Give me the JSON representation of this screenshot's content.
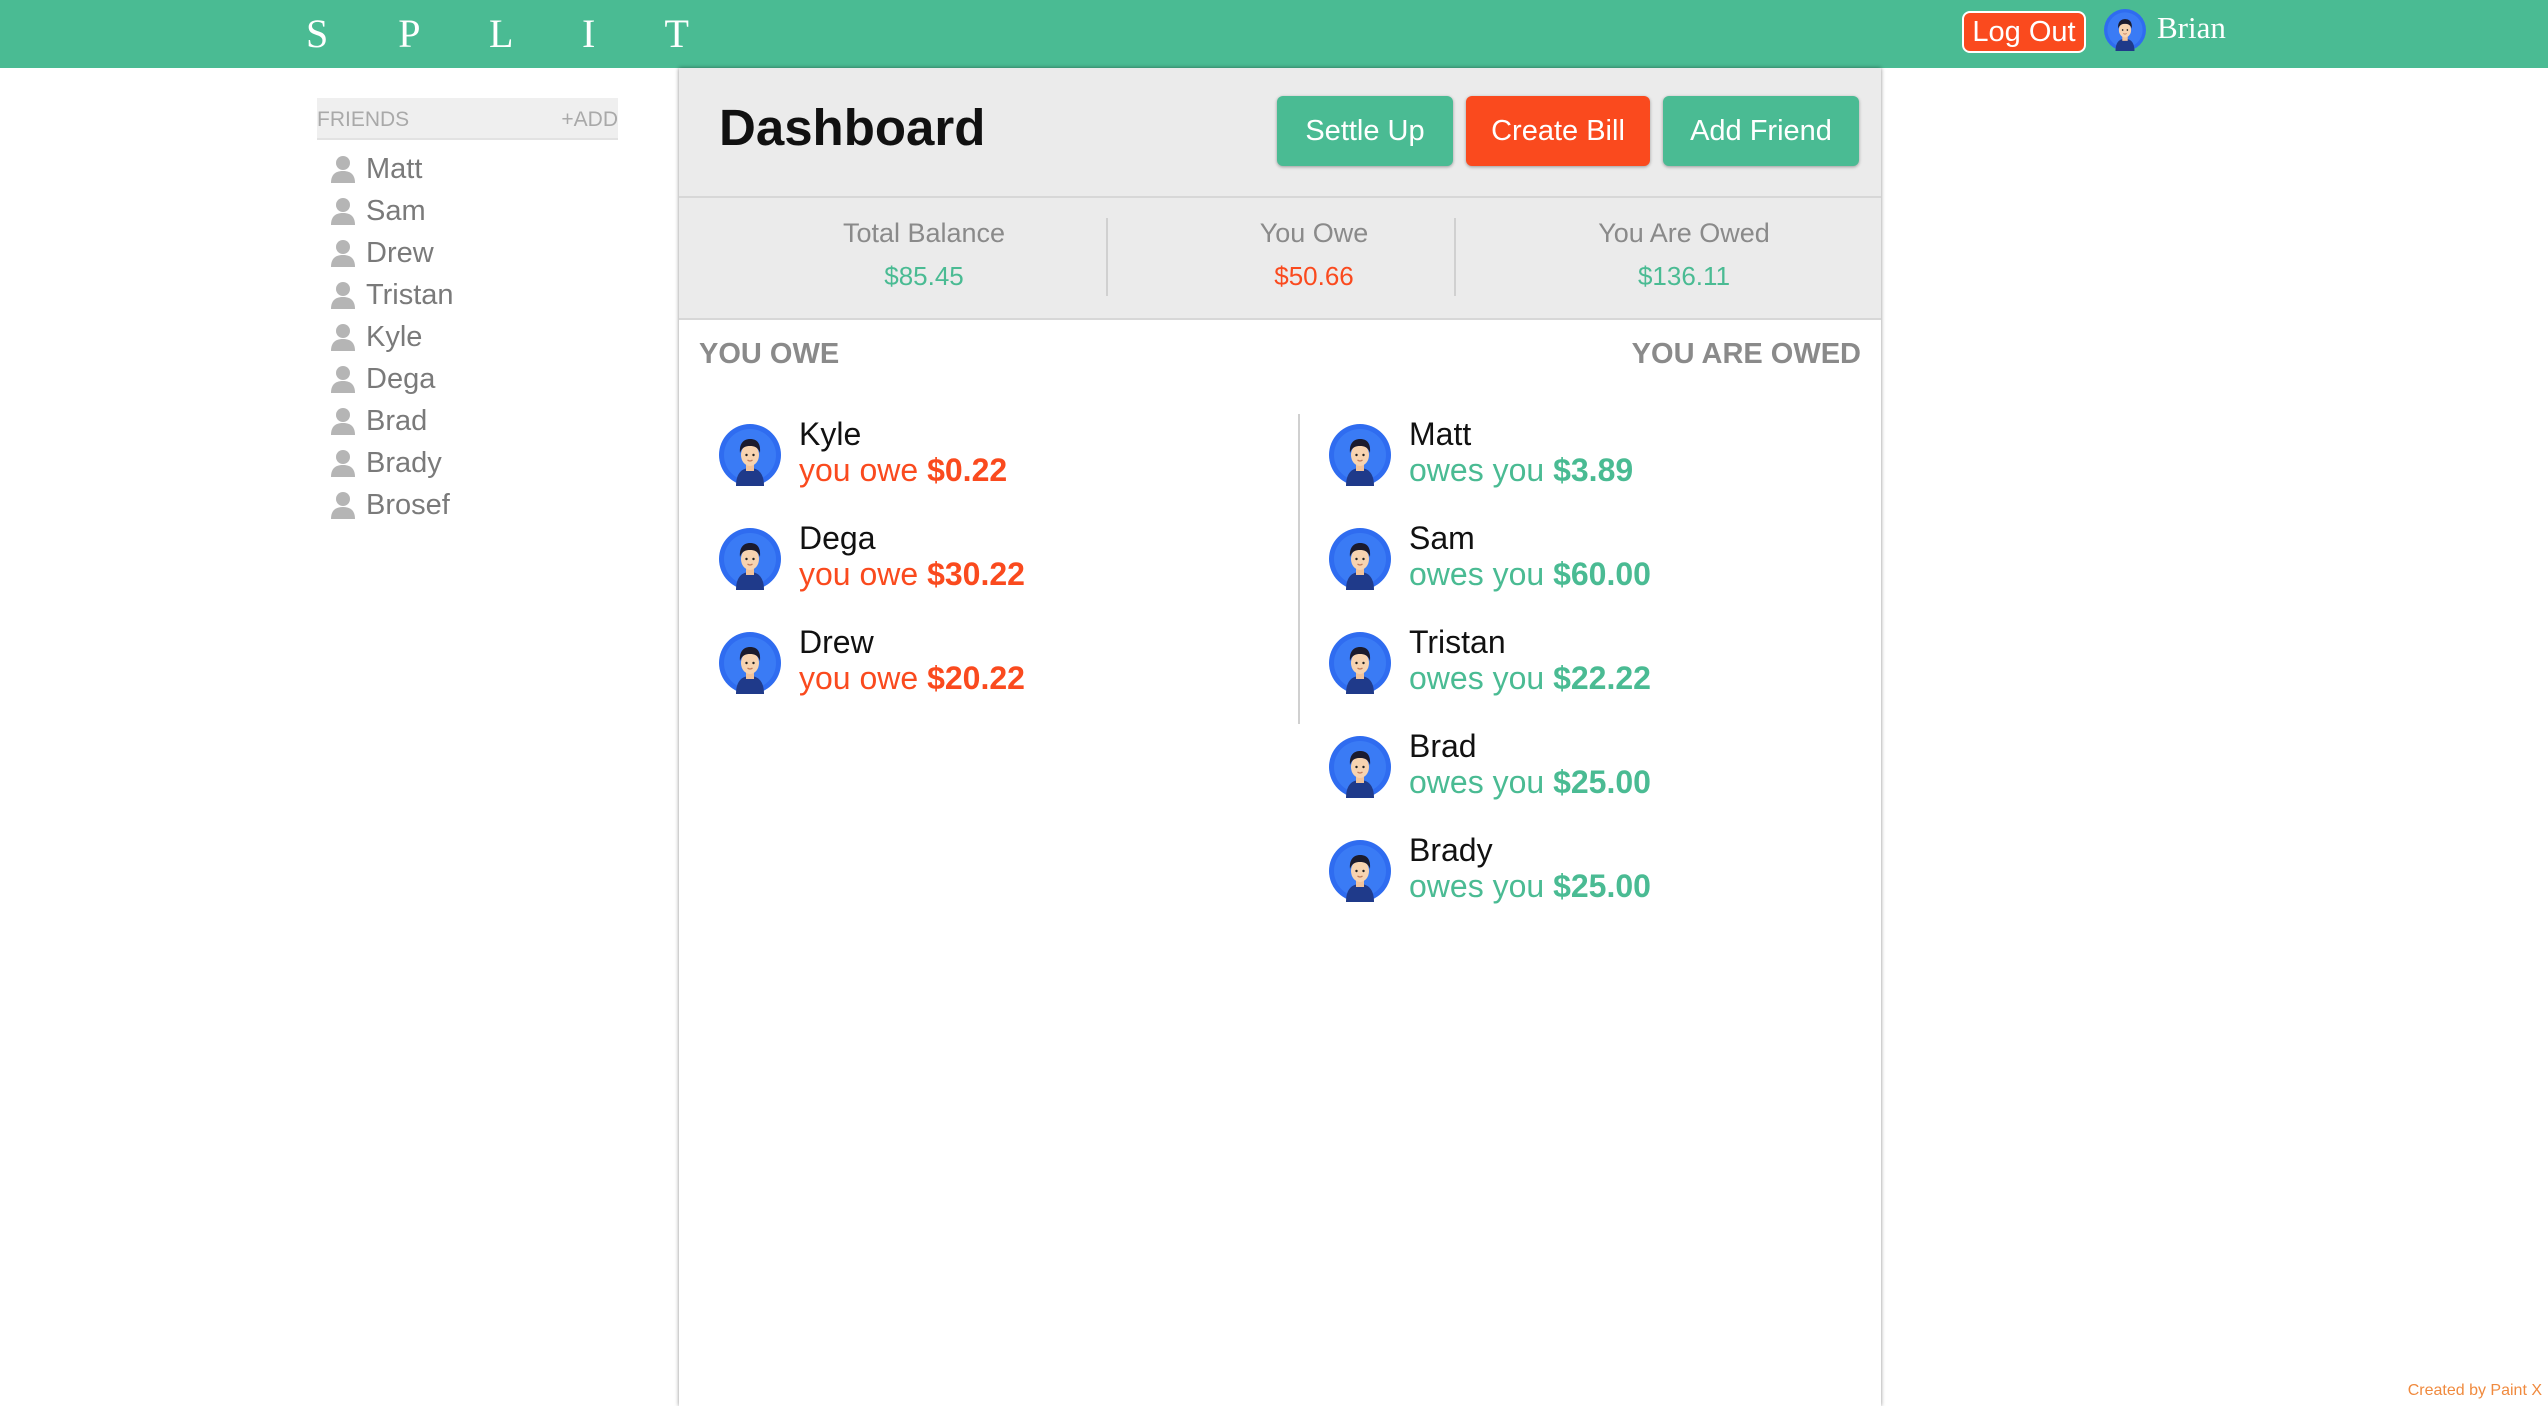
{
  "header": {
    "brand": "S P L I T",
    "logout_label": "Log Out",
    "user_name": "Brian"
  },
  "sidebar": {
    "title": "FRIENDS",
    "add_label": "+ADD",
    "friends": [
      "Matt",
      "Sam",
      "Drew",
      "Tristan",
      "Kyle",
      "Dega",
      "Brad",
      "Brady",
      "Brosef"
    ]
  },
  "dashboard": {
    "title": "Dashboard",
    "buttons": {
      "settle_up": "Settle Up",
      "create_bill": "Create Bill",
      "add_friend": "Add Friend"
    },
    "stats": {
      "total_balance_label": "Total Balance",
      "total_balance_value": "$85.45",
      "you_owe_label": "You Owe",
      "you_owe_value": "$50.66",
      "you_are_owed_label": "You Are Owed",
      "you_are_owed_value": "$136.11"
    },
    "you_owe_title": "YOU OWE",
    "you_are_owed_title": "YOU ARE OWED",
    "owe_prefix": "you owe",
    "owed_prefix": "owes you",
    "you_owe": [
      {
        "name": "Kyle",
        "amount": "$0.22"
      },
      {
        "name": "Dega",
        "amount": "$30.22"
      },
      {
        "name": "Drew",
        "amount": "$20.22"
      }
    ],
    "you_are_owed": [
      {
        "name": "Matt",
        "amount": "$3.89"
      },
      {
        "name": "Sam",
        "amount": "$60.00"
      },
      {
        "name": "Tristan",
        "amount": "$22.22"
      },
      {
        "name": "Brad",
        "amount": "$25.00"
      },
      {
        "name": "Brady",
        "amount": "$25.00"
      }
    ]
  },
  "footer": {
    "credit": "Created by Paint X"
  },
  "colors": {
    "brand_green": "#4abb93",
    "alert_red": "#fa4a1e",
    "avatar_blue": "#2f6cf0"
  },
  "icons": {
    "friend": "person-silhouette-icon",
    "avatar": "user-avatar-icon"
  }
}
